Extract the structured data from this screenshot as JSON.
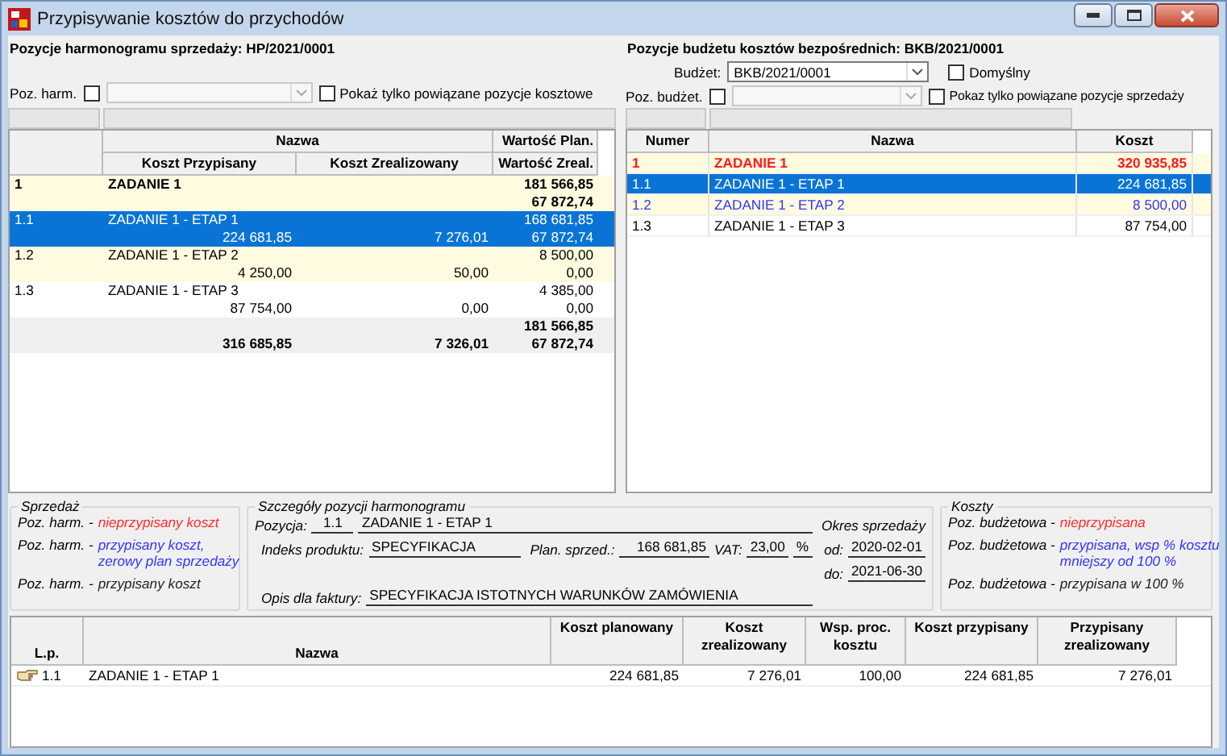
{
  "window": {
    "title": "Przypisywanie kosztów do przychodów"
  },
  "sales_panel": {
    "heading": "Pozycje harmonogramu sprzedaży: HP/2021/0001",
    "filter": {
      "label": "Poz. harm.",
      "checked": false,
      "combo_disabled": true
    },
    "show_only": {
      "label": "Pokaż tylko powiązane pozycje kosztowe",
      "checked": false
    },
    "table": {
      "group_header": "Nazwa",
      "columns": [
        "Koszt Przypisany",
        "Koszt Zrealizowany"
      ],
      "value_headers": [
        "Wartość Plan.",
        "Wartość Zreal."
      ],
      "rows": [
        {
          "kind": "group",
          "selected": false,
          "number": "1",
          "name": "ZADANIE 1",
          "plan": "181 566,85",
          "real_value": "67 872,74"
        },
        {
          "kind": "item",
          "selected": true,
          "number": "1.1",
          "name": "ZADANIE 1 - ETAP 1",
          "plan": "168 681,85",
          "assigned": "224 681,85",
          "realized": "7 276,01",
          "real_value": "67 872,74"
        },
        {
          "kind": "item",
          "selected": false,
          "number": "1.2",
          "name": "ZADANIE 1 - ETAP 2",
          "plan": "8 500,00",
          "assigned": "4 250,00",
          "realized": "50,00",
          "real_value": "0,00"
        },
        {
          "kind": "item",
          "selected": false,
          "number": "1.3",
          "name": "ZADANIE 1 - ETAP 3",
          "plan": "4 385,00",
          "assigned": "87 754,00",
          "realized": "0,00",
          "real_value": "0,00"
        }
      ],
      "totals": {
        "plan": "181 566,85",
        "assigned": "316 685,85",
        "realized": "7 326,01",
        "real_value": "67 872,74"
      }
    }
  },
  "budget_panel": {
    "heading": "Pozycje budżetu kosztów bezpośrednich: BKB/2021/0001",
    "budget": {
      "label": "Budżet:",
      "value": "BKB/2021/0001",
      "combo_disabled": false
    },
    "default": {
      "label": "Domyślny",
      "checked": false
    },
    "filter": {
      "label": "Poz. budżet.",
      "checked": false,
      "combo_disabled": true
    },
    "show_only": {
      "label": "Pokaz tylko powiązane pozycje sprzedaży",
      "checked": false
    },
    "table": {
      "columns": [
        "Numer",
        "Nazwa",
        "Koszt"
      ],
      "rows": [
        {
          "kind": "group",
          "selected": false,
          "number": "1",
          "name": "ZADANIE 1",
          "cost": "320 935,85",
          "color": "#ff1a1a"
        },
        {
          "kind": "item",
          "selected": true,
          "number": "1.1",
          "name": "ZADANIE 1 - ETAP 1",
          "cost": "224 681,85"
        },
        {
          "kind": "item",
          "selected": false,
          "number": "1.2",
          "name": "ZADANIE 1 - ETAP 2",
          "cost": "8 500,00",
          "color": "#3333ff"
        },
        {
          "kind": "item",
          "selected": false,
          "number": "1.3",
          "name": "ZADANIE 1 - ETAP 3",
          "cost": "87 754,00",
          "color": "#000000"
        }
      ]
    }
  },
  "sales_legend": {
    "title": "Sprzedaż",
    "items": [
      {
        "prefix": "Poz. harm. -",
        "lines": [
          "nieprzypisany koszt"
        ],
        "color": "#ff2a2a"
      },
      {
        "prefix": "Poz. harm. -",
        "lines": [
          "przypisany koszt,",
          "zerowy plan sprzedaży"
        ],
        "color": "#3333ff"
      },
      {
        "prefix": "Poz. harm. -",
        "lines": [
          "przypisany koszt"
        ],
        "color": "#222222"
      }
    ]
  },
  "details": {
    "title": "Szczegóły pozycji harmonogramu",
    "position": {
      "label": "Pozycja:",
      "number": "1.1",
      "name": "ZADANIE 1 - ETAP 1"
    },
    "product_index": {
      "label": "Indeks produktu:",
      "value": "SPECYFIKACJA"
    },
    "plan": {
      "label": "Plan. sprzed.:",
      "value": "168 681,85"
    },
    "vat": {
      "label": "VAT:",
      "value": "23,00",
      "unit": "%"
    },
    "period": {
      "label": "Okres sprzedaży",
      "from_label": "od:",
      "from": "2020-02-01",
      "to_label": "do:",
      "to": "2021-06-30"
    },
    "invoice": {
      "label": "Opis dla faktury:",
      "value": "SPECYFIKACJA ISTOTNYCH WARUNKÓW ZAMÓWIENIA"
    }
  },
  "cost_legend": {
    "title": "Koszty",
    "items": [
      {
        "prefix": "Poz. budżetowa -",
        "lines": [
          "nieprzypisana"
        ],
        "color": "#ff2a2a"
      },
      {
        "prefix": "Poz. budżetowa -",
        "lines": [
          "przypisana, wsp % kosztu",
          "mniejszy od 100 %"
        ],
        "color": "#3333ff"
      },
      {
        "prefix": "Poz. budżetowa -",
        "lines": [
          "przypisana w 100 %"
        ],
        "color": "#222222"
      }
    ]
  },
  "assignments": {
    "columns": [
      "L.p.",
      "Nazwa",
      "Koszt planowany",
      "Koszt zrealizowany",
      "Wsp. proc. kosztu",
      "Koszt przypisany",
      "Przypisany zrealizowany"
    ],
    "rows": [
      {
        "current": true,
        "cells": [
          "1.1",
          "ZADANIE 1 - ETAP 1",
          "224 681,85",
          "7 276,01",
          "100,00",
          "224 681,85",
          "7 276,01"
        ]
      }
    ]
  }
}
